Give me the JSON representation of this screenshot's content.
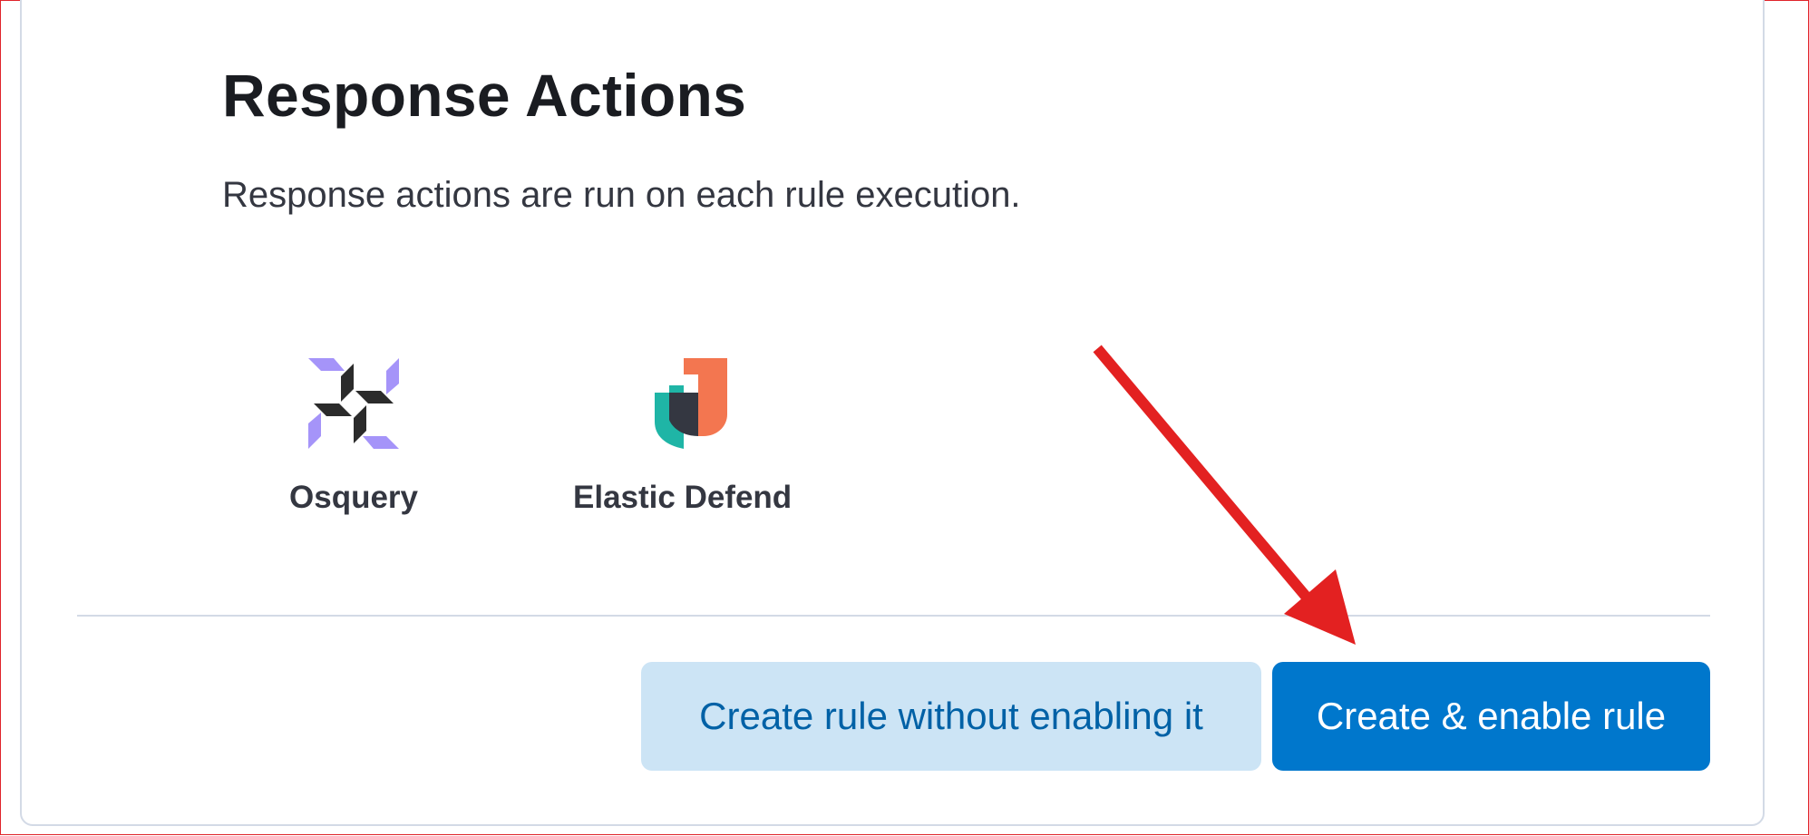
{
  "section": {
    "title": "Response Actions",
    "description": "Response actions are run on each rule execution."
  },
  "action_types": [
    {
      "label": "Osquery",
      "icon": "osquery-logo-icon"
    },
    {
      "label": "Elastic Defend",
      "icon": "elastic-defend-logo-icon"
    }
  ],
  "buttons": {
    "create_without_enabling": "Create rule without enabling it",
    "create_and_enable": "Create & enable rule"
  },
  "colors": {
    "primary": "#0077cc",
    "secondary_bg": "#cce4f5",
    "secondary_text": "#0061a6",
    "annotation_arrow": "#e32121",
    "osquery_purple": "#a594f9",
    "osquery_dark": "#2b2b2b",
    "defend_teal": "#1fb5a6",
    "defend_orange": "#f37650"
  }
}
